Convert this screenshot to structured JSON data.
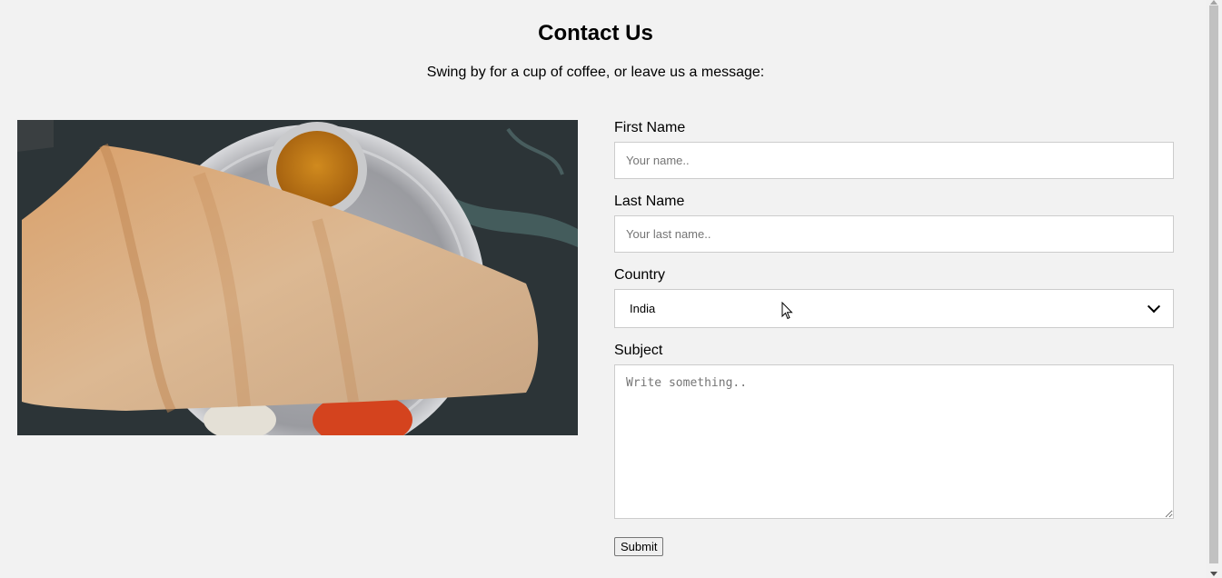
{
  "header": {
    "title": "Contact Us",
    "subtitle": "Swing by for a cup of coffee, or leave us a message:"
  },
  "form": {
    "first_name_label": "First Name",
    "first_name_placeholder": "Your name..",
    "last_name_label": "Last Name",
    "last_name_placeholder": "Your last name..",
    "country_label": "Country",
    "country_selected": "India",
    "subject_label": "Subject",
    "subject_placeholder": "Write something..",
    "submit_label": "Submit"
  },
  "colors": {
    "background": "#f2f2f2",
    "input_border": "#cccccc"
  }
}
